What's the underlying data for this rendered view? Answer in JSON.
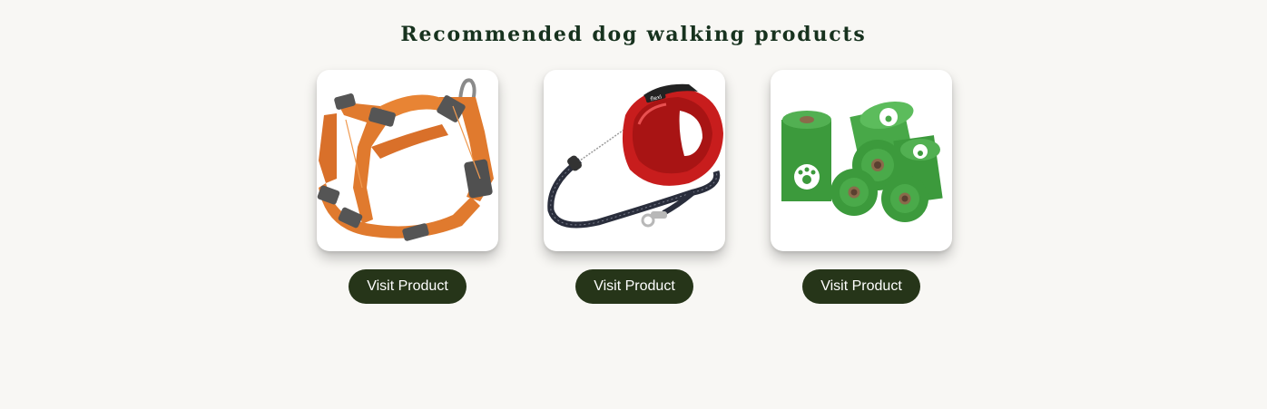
{
  "section": {
    "title": "Recommended dog walking products"
  },
  "products": [
    {
      "image_icon": "orange-dog-harness-image",
      "button_label": "Visit Product"
    },
    {
      "image_icon": "red-retractable-leash-image",
      "button_label": "Visit Product"
    },
    {
      "image_icon": "green-poop-bag-rolls-image",
      "button_label": "Visit Product"
    }
  ],
  "colors": {
    "page_background": "#f8f7f4",
    "title": "#17321e",
    "button_background": "#263519",
    "button_text": "#ffffff",
    "card_background": "#ffffff"
  }
}
